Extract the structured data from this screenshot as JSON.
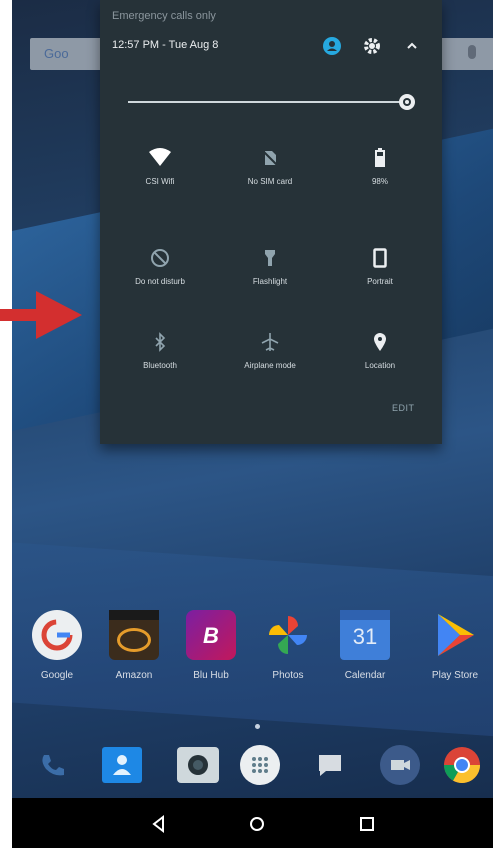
{
  "status_shade": {
    "carrier_text": "Emergency calls only",
    "datetime": "12:57 PM - Tue Aug 8",
    "icons": [
      "account-icon",
      "gear-icon",
      "chevron-up-icon"
    ],
    "brightness_level": 0.95,
    "tiles": [
      {
        "name": "wifi",
        "label": "CSI Wifi",
        "icon": "wifi-icon"
      },
      {
        "name": "cellular",
        "label": "No SIM card",
        "icon": "no-sim-icon"
      },
      {
        "name": "battery",
        "label": "98%",
        "icon": "battery-icon"
      },
      {
        "name": "dnd",
        "label": "Do not disturb",
        "icon": "dnd-icon"
      },
      {
        "name": "flashlight",
        "label": "Flashlight",
        "icon": "flashlight-icon"
      },
      {
        "name": "rotation",
        "label": "Portrait",
        "icon": "portrait-icon"
      },
      {
        "name": "bluetooth",
        "label": "Bluetooth",
        "icon": "bluetooth-icon"
      },
      {
        "name": "airplane",
        "label": "Airplane mode",
        "icon": "airplane-icon"
      },
      {
        "name": "location",
        "label": "Location",
        "icon": "location-icon"
      }
    ],
    "edit_label": "EDIT"
  },
  "home_screen": {
    "apps": [
      {
        "label": "Google",
        "color": "#e9ecef"
      },
      {
        "label": "Amazon",
        "color": "#3b2c1c"
      },
      {
        "label": "Blu Hub",
        "color": "#c2185b"
      },
      {
        "label": "Photos",
        "color": "#fbbc05"
      },
      {
        "label": "Calendar",
        "color": "#3f7fd9"
      },
      {
        "label": "Play Store",
        "color": "#34a853"
      }
    ],
    "dock": [
      {
        "name": "phone-icon",
        "color": "#1d3b5d"
      },
      {
        "name": "contacts-icon",
        "color": "#1e88e5"
      },
      {
        "name": "camera-icon",
        "color": "#455a64"
      },
      {
        "name": "app-drawer-icon",
        "color": "#eceff1"
      },
      {
        "name": "messages-icon",
        "color": "#e0e0e0"
      },
      {
        "name": "duo-icon",
        "color": "#3c5a8a"
      },
      {
        "name": "chrome-icon",
        "color": "#db4437"
      }
    ]
  },
  "colors": {
    "annotation_arrow": "#d32f2f",
    "shade_bg": "#263238",
    "accent": "#26a9e0"
  }
}
